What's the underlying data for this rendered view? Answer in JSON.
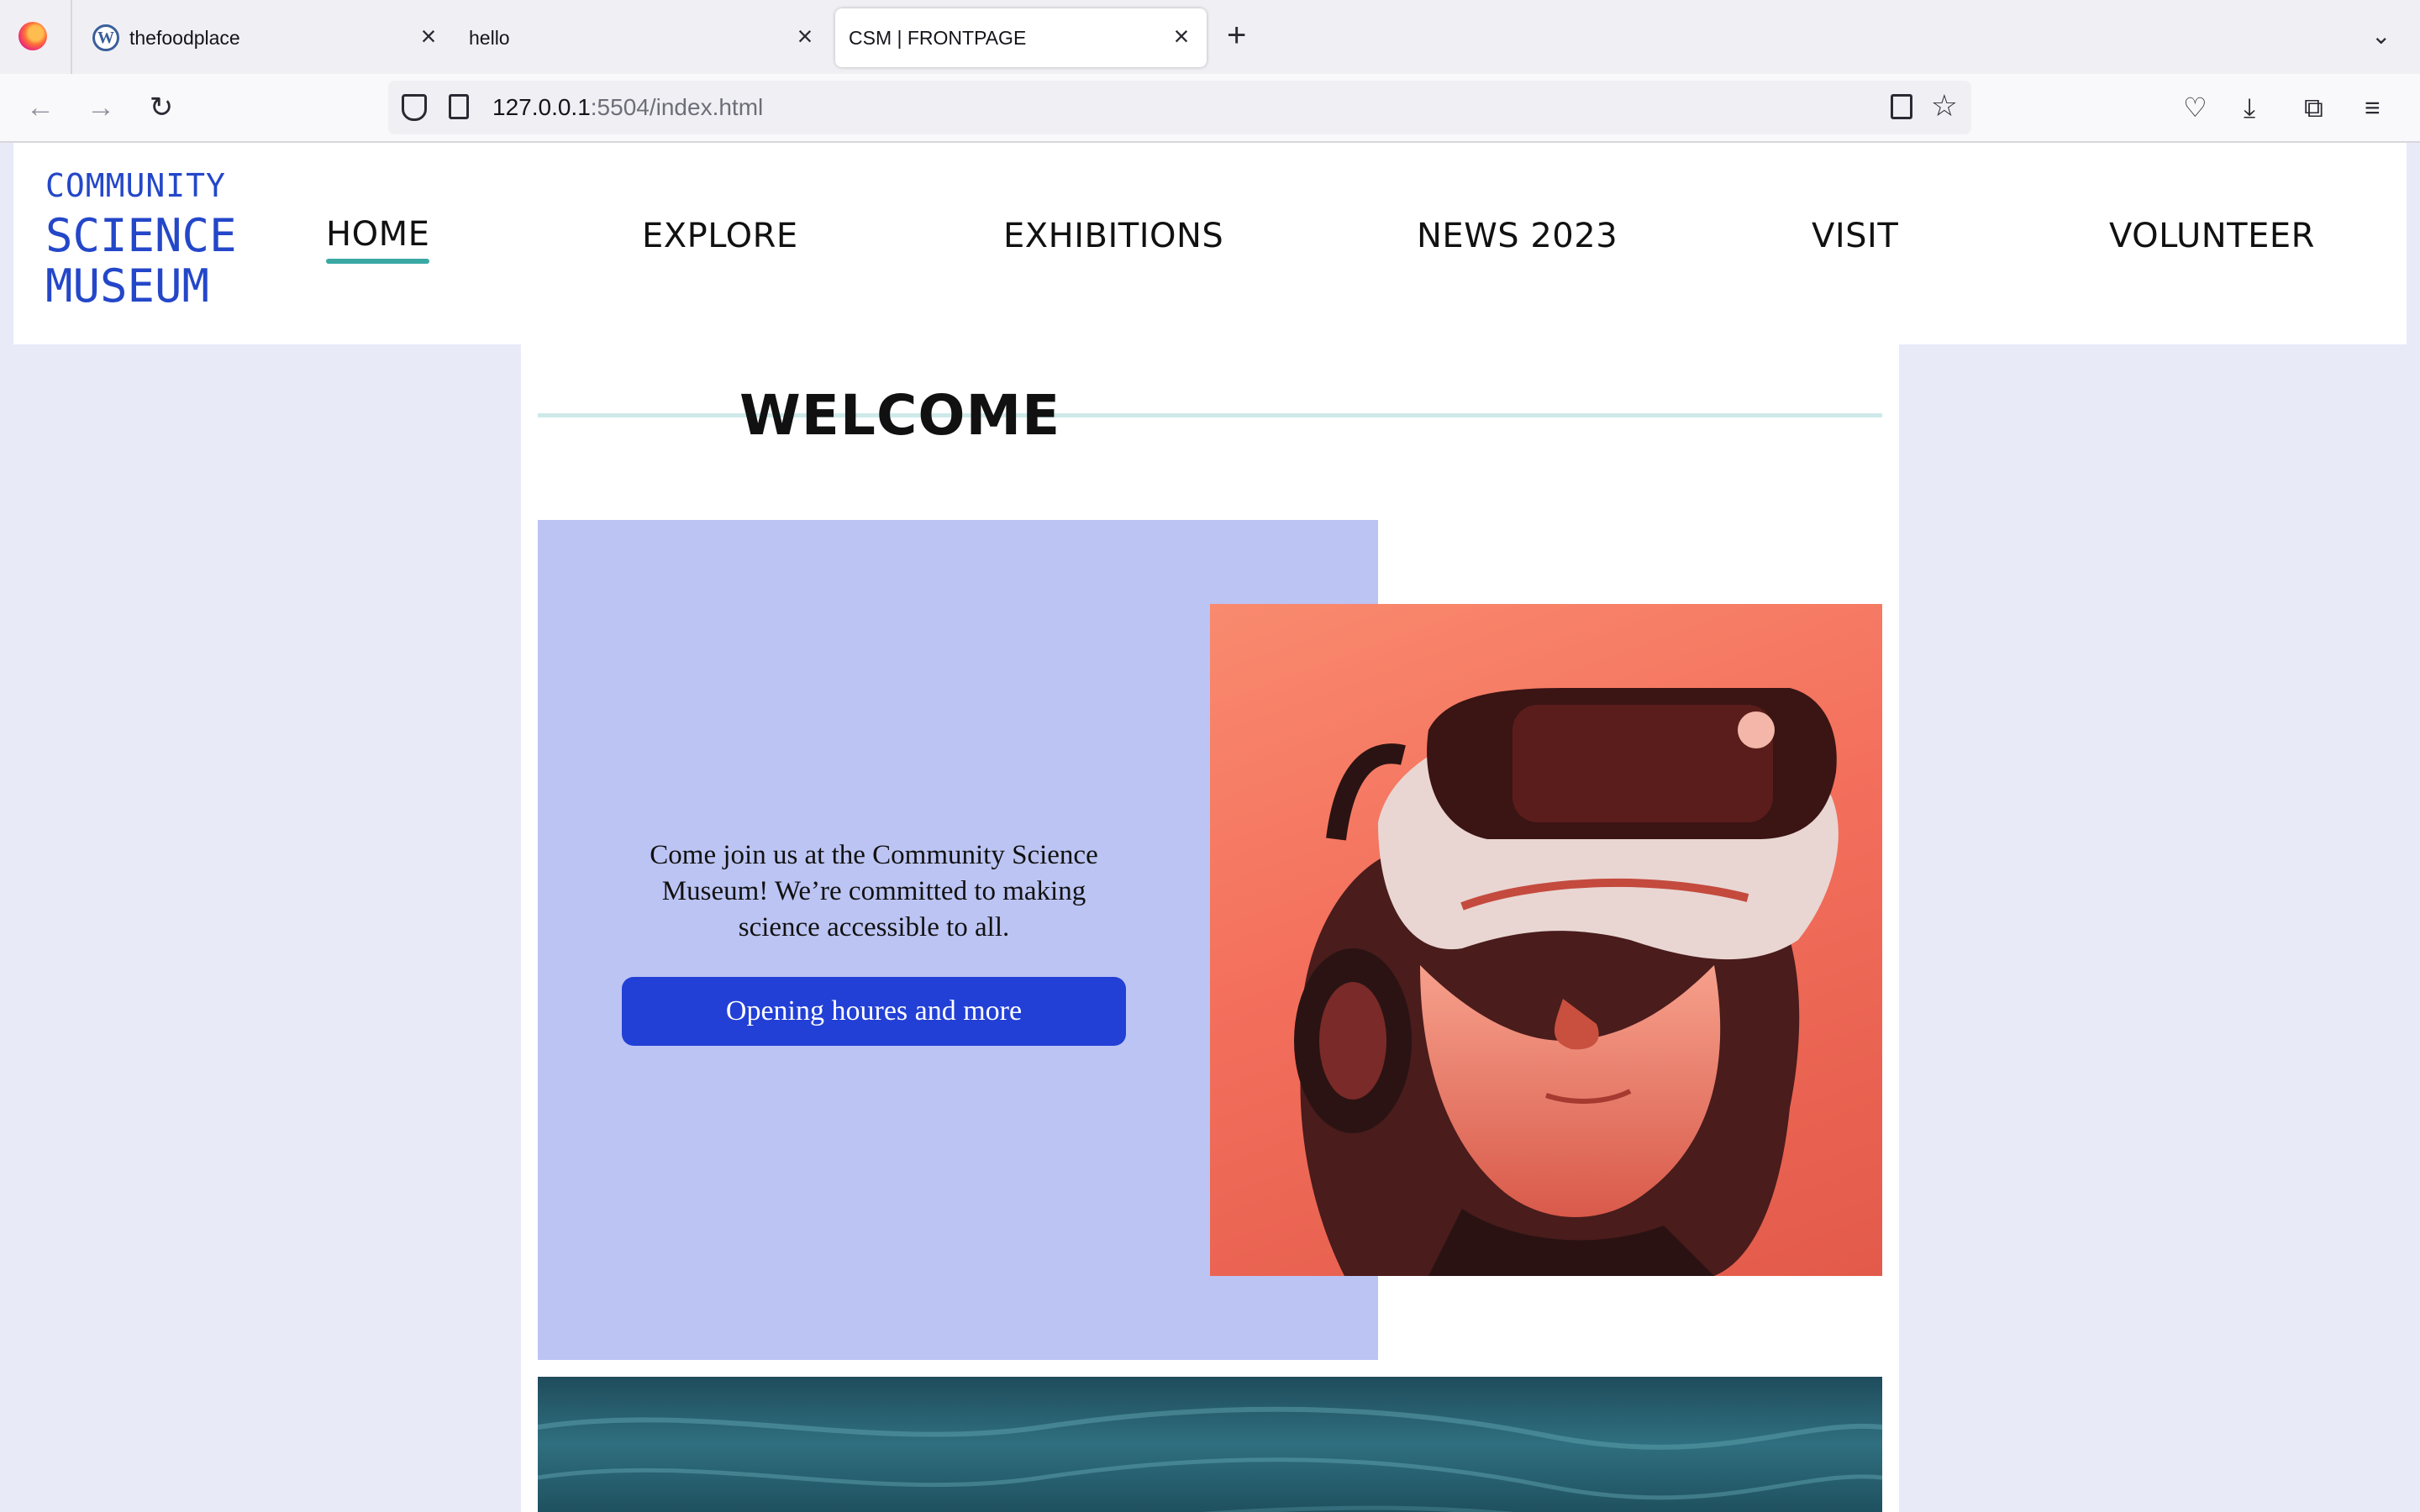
{
  "browser": {
    "tabs": [
      {
        "title": "thefoodplace",
        "favicon": "wordpress-icon"
      },
      {
        "title": "hello"
      },
      {
        "title": "CSM | FRONTPAGE",
        "active": true
      }
    ],
    "url_host": "127.0.0.1",
    "url_rest": ":5504/index.html"
  },
  "site": {
    "logo": {
      "line1": "COMMUNITY",
      "line2": "SCIENCE",
      "line3": "MUSEUM"
    },
    "menu": [
      "HOME",
      "EXPLORE",
      "EXHIBITIONS",
      "NEWS 2023",
      "VISIT",
      "VOLUNTEER"
    ],
    "active_menu": "HOME",
    "welcome": "WELCOME",
    "hero_text": "Come join us at the Community Science Museum! We’re committed to making science accessible to all.",
    "hero_button": "Opening houres and more"
  },
  "colors": {
    "accent": "#2447c9",
    "button": "#2240d6",
    "hero_block": "#bcc4f3",
    "underline": "#3aa8a3",
    "page_bg": "#e9eaf8"
  }
}
